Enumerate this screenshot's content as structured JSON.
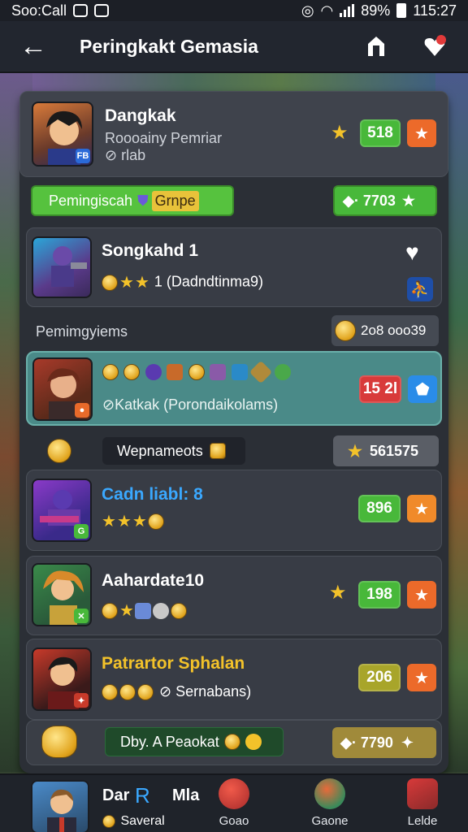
{
  "status_bar": {
    "carrier": "Soo:Call",
    "battery": "89%",
    "time": "115:27"
  },
  "header": {
    "title": "Peringkakt Gemasia"
  },
  "cards": [
    {
      "title": "Dangkak",
      "subtitle": "Roooainy Pemriar",
      "meta": "⊘ rlab",
      "score": "518"
    },
    {
      "title": "Songkahd 1",
      "rating_text": "1 (Dadndtinma9)"
    },
    {
      "subtitle": "⊘Katkak (Porondaikolams)",
      "score": "15 2l"
    },
    {
      "title": "Cadn liabl: 8",
      "score": "896"
    },
    {
      "title": "Aahardate10",
      "score": "198"
    },
    {
      "title": "Patrartor Sphalan",
      "subtitle": "⊘ Sernabans)",
      "score": "206"
    }
  ],
  "banners": {
    "ranking_group": {
      "label": "Pemingiscah",
      "tag": "Grnpe",
      "value": "· 7703"
    },
    "section_label": "Pemimgyiems",
    "section_value": "2o8 ooo39",
    "tournament": {
      "label": "Wepnameots",
      "value": "561575"
    },
    "daily": {
      "label": "Dby. A Peaokat",
      "value": "· 7790"
    }
  },
  "bottom_nav": [
    {
      "label": "Dar",
      "sublabel": "Saveral",
      "suffix": "Mla"
    },
    {
      "label": "Goao"
    },
    {
      "label": "Gaone"
    },
    {
      "label": "Lelde"
    }
  ],
  "colors": {
    "accent_green": "#48b83a",
    "accent_orange": "#ec6a2a",
    "accent_red": "#d83a3a",
    "panel": "#2b2f36",
    "card": "#383c45"
  }
}
